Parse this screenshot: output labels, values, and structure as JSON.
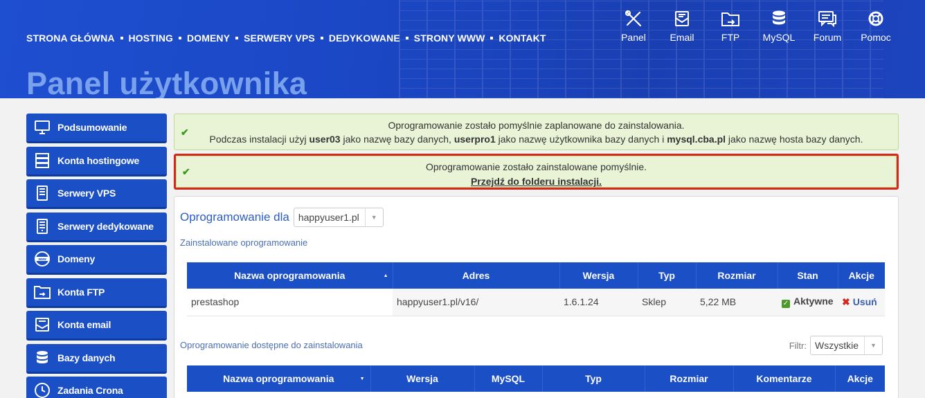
{
  "nav": {
    "items": [
      "STRONA GŁÓWNA",
      "HOSTING",
      "DOMENY",
      "SERWERY VPS",
      "DEDYKOWANE",
      "STRONY WWW",
      "KONTAKT"
    ]
  },
  "quicklinks": [
    {
      "label": "Panel",
      "icon": "tools-icon"
    },
    {
      "label": "Email",
      "icon": "email-icon"
    },
    {
      "label": "FTP",
      "icon": "ftp-folder-icon"
    },
    {
      "label": "MySQL",
      "icon": "database-icon"
    },
    {
      "label": "Forum",
      "icon": "chat-icon"
    },
    {
      "label": "Pomoc",
      "icon": "lifebuoy-icon"
    }
  ],
  "page_title": "Panel użytkownika",
  "sidebar": {
    "items": [
      {
        "label": "Podsumowanie",
        "icon": "monitor-icon"
      },
      {
        "label": "Konta hostingowe",
        "icon": "server-icon"
      },
      {
        "label": "Serwery VPS",
        "icon": "vps-icon"
      },
      {
        "label": "Serwery dedykowane",
        "icon": "dedicated-server-icon"
      },
      {
        "label": "Domeny",
        "icon": "www-globe-icon"
      },
      {
        "label": "Konta FTP",
        "icon": "ftp-folder-icon"
      },
      {
        "label": "Konta email",
        "icon": "email-icon"
      },
      {
        "label": "Bazy danych",
        "icon": "database-icon"
      },
      {
        "label": "Zadania Crona",
        "icon": "clock-icon"
      }
    ]
  },
  "alerts": {
    "first": {
      "line1": "Oprogramowanie zostało pomyślnie zaplanowane do zainstalowania.",
      "l2_a": "Podczas instalacji użyj ",
      "l2_db": "user03",
      "l2_b": " jako nazwę bazy danych, ",
      "l2_user": "userpro1",
      "l2_c": " jako nazwę użytkownika bazy danych i ",
      "l2_host": "mysql.cba.pl",
      "l2_d": " jako nazwę hosta bazy danych."
    },
    "second": {
      "line1": "Oprogramowanie zostało zainstalowane pomyślnie.",
      "link": "Przejdź do folderu instalacji."
    }
  },
  "panel": {
    "title": "Oprogramowanie dla",
    "domain_select": "happyuser1.pl",
    "installed_label": "Zainstalowane oprogramowanie",
    "installed_table": {
      "headers": [
        "Nazwa oprogramowania",
        "Adres",
        "Wersja",
        "Typ",
        "Rozmiar",
        "Stan",
        "Akcje"
      ],
      "rows": [
        {
          "name": "prestashop",
          "address": "happyuser1.pl/v16/",
          "version": "1.6.1.24",
          "type": "Sklep",
          "size": "5,22 MB",
          "status": "Aktywne",
          "action": "Usuń"
        }
      ]
    },
    "available_label": "Oprogramowanie dostępne do zainstalowania",
    "filter_label": "Filtr:",
    "filter_value": "Wszystkie",
    "available_table": {
      "headers": [
        "Nazwa oprogramowania",
        "Wersja",
        "MySQL",
        "Typ",
        "Rozmiar",
        "Komentarze",
        "Akcje"
      ]
    }
  }
}
